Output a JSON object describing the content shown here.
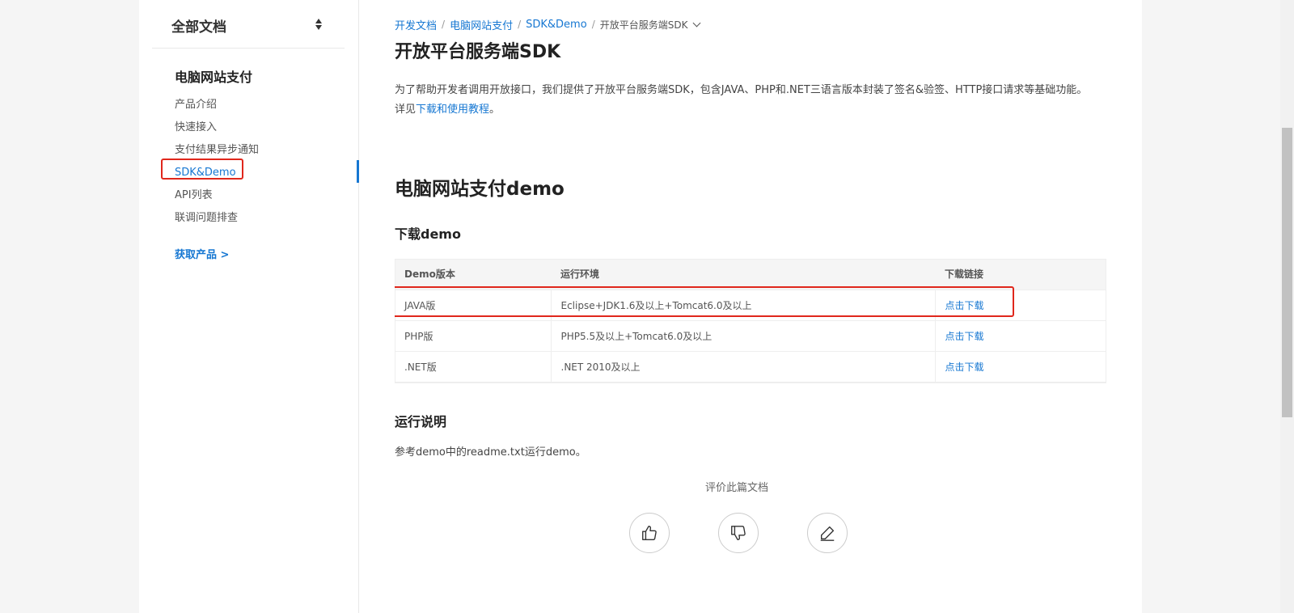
{
  "sidebar": {
    "header_title": "全部文档",
    "section_title": "电脑网站支付",
    "items": [
      {
        "label": "产品介绍"
      },
      {
        "label": "快速接入"
      },
      {
        "label": "支付结果异步通知"
      },
      {
        "label": "SDK&Demo"
      },
      {
        "label": "API列表"
      },
      {
        "label": "联调问题排查"
      }
    ],
    "get_product": "获取产品 >"
  },
  "breadcrumb": {
    "items": [
      "开发文档",
      "电脑网站支付",
      "SDK&Demo"
    ],
    "current": "开放平台服务端SDK"
  },
  "content": {
    "sdk_title": "开放平台服务端SDK",
    "sdk_desc": "为了帮助开发者调用开放接口，我们提供了开放平台服务端SDK，包含JAVA、PHP和.NET三语言版本封装了签名&验签、HTTP接口请求等基础功能。",
    "detail_prefix": "详见",
    "detail_link": "下载和使用教程",
    "detail_suffix": "。",
    "demo_title": "电脑网站支付demo",
    "download_title": "下载demo",
    "table": {
      "headers": [
        "Demo版本",
        "运行环境",
        "下载链接"
      ],
      "rows": [
        [
          "JAVA版",
          "Eclipse+JDK1.6及以上+Tomcat6.0及以上",
          "点击下载"
        ],
        [
          "PHP版",
          "PHP5.5及以上+Tomcat6.0及以上",
          "点击下载"
        ],
        [
          ".NET版",
          ".NET 2010及以上",
          "点击下载"
        ]
      ]
    },
    "run_title": "运行说明",
    "run_desc": "参考demo中的readme.txt运行demo。",
    "rate_label": "评价此篇文档"
  },
  "icons": {
    "sort": "sort-icon",
    "chevron": "chevron-down-icon",
    "like": "thumbs-up-icon",
    "dislike": "thumbs-down-icon",
    "edit": "pencil-icon"
  },
  "colors": {
    "link": "#1677d2",
    "highlight": "#e0271c"
  }
}
